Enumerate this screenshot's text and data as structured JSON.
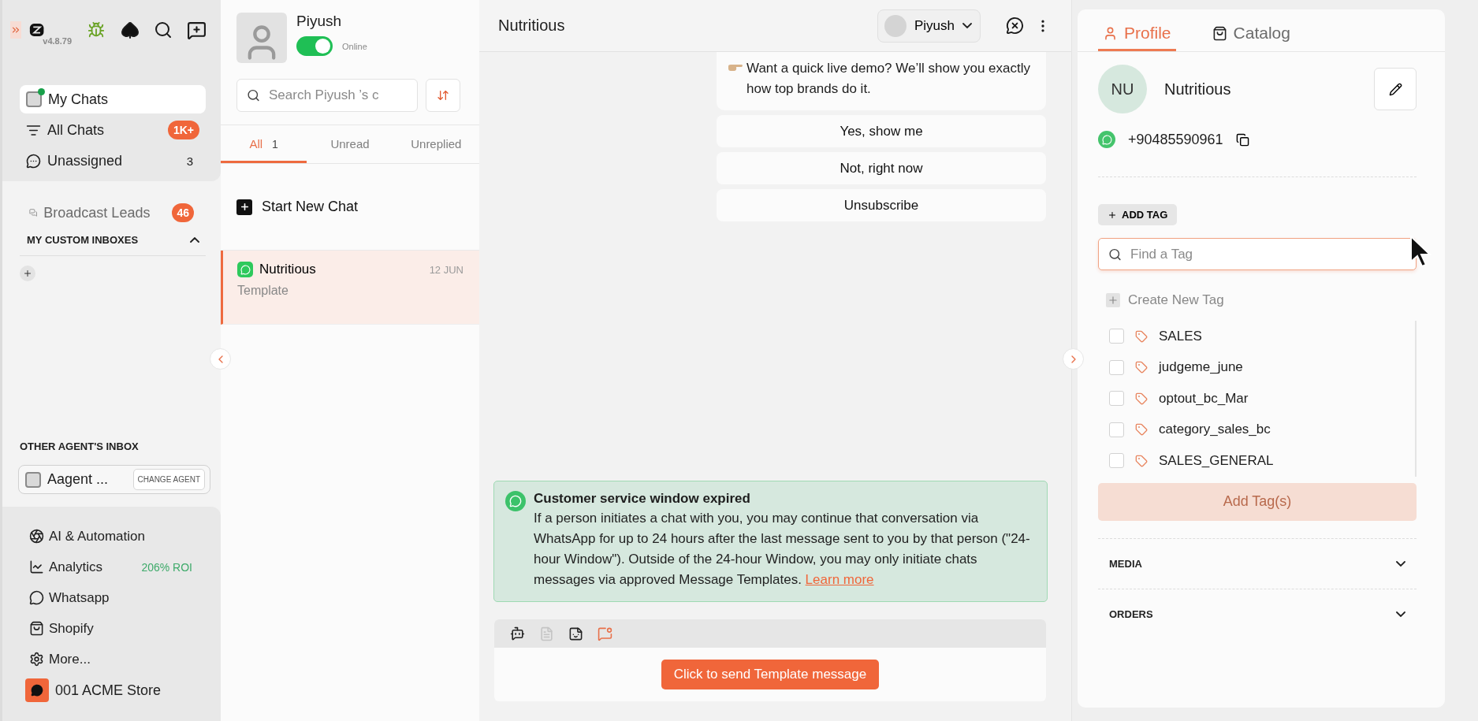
{
  "app": {
    "version": "v4.8.79"
  },
  "sidebar": {
    "nav": [
      {
        "label": "My Chats",
        "selected": true,
        "online": true
      },
      {
        "label": "All Chats",
        "selected": false,
        "badge": "1K+"
      },
      {
        "label": "Unassigned",
        "selected": false,
        "count": "3"
      }
    ],
    "broadcast": {
      "label": "Broadcast Leads",
      "badge": "46"
    },
    "custom_inboxes": {
      "title": "MY CUSTOM INBOXES",
      "expanded": true
    },
    "other_agents": {
      "title": "OTHER AGENT'S INBOX",
      "agent": "Aagent ...",
      "button": "CHANGE AGENT"
    },
    "menu": [
      {
        "label": "AI & Automation"
      },
      {
        "label": "Analytics",
        "note": "206% ROI"
      },
      {
        "label": "Whatsapp"
      },
      {
        "label": "Shopify"
      },
      {
        "label": "More..."
      }
    ],
    "store": "001 ACME Store"
  },
  "chat_list": {
    "user": "Piyush",
    "online": true,
    "status": "Online",
    "search_placeholder": "Search Piyush ’s c",
    "tabs": [
      {
        "label": "All",
        "count": "1",
        "selected": true
      },
      {
        "label": "Unread",
        "selected": false
      },
      {
        "label": "Unreplied",
        "selected": false
      }
    ],
    "start_new_chat": "Start New Chat",
    "chats": [
      {
        "name": "Nutritious",
        "date": "12 JUN",
        "preview": "Template",
        "selected": true
      }
    ]
  },
  "chat": {
    "title": "Nutritious",
    "assignee": "Piyush",
    "message": "Want a quick live demo? We’ll show you exactly how top brands do it.",
    "quick_replies": [
      "Yes, show me",
      "Not, right now",
      "Unsubscribe"
    ],
    "notice": {
      "title": "Customer service window expired",
      "body": "If a person initiates a chat with you, you may continue that conversation via WhatsApp for up to 24 hours after the last message sent to you by that person (\"24-hour Window\"). Outside of the 24-hour Window, you may only initiate chats messages via approved Message Templates.",
      "link": "Learn more"
    },
    "send_button": "Click to send Template message"
  },
  "profile_panel": {
    "tabs": [
      {
        "label": "Profile",
        "selected": true
      },
      {
        "label": "Catalog",
        "selected": false
      }
    ],
    "contact": {
      "initials": "NU",
      "name": "Nutritious",
      "phone": "+90485590961"
    },
    "add_tag": "ADD TAG",
    "tag_search_placeholder": "Find a Tag",
    "create_tag": "Create New Tag",
    "tags": [
      {
        "name": "SALES",
        "checked": false
      },
      {
        "name": "judgeme_june",
        "checked": false
      },
      {
        "name": "optout_bc_Mar",
        "checked": false
      },
      {
        "name": "category_sales_bc",
        "checked": false
      },
      {
        "name": "SALES_GENERAL",
        "checked": false
      }
    ],
    "add_tags_button": {
      "label": "Add Tag(s)",
      "disabled": true
    },
    "sections": [
      {
        "title": "MEDIA",
        "expanded": false
      },
      {
        "title": "ORDERS",
        "expanded": false
      }
    ]
  }
}
